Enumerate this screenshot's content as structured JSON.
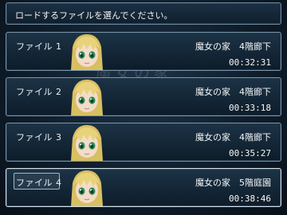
{
  "header": {
    "prompt": "ロードするファイルを選んでください。"
  },
  "watermark": "魔女の家",
  "slots": [
    {
      "label": "ファイル 1",
      "location": "魔女の家　4階廊下",
      "time": "00:32:31",
      "selected": false
    },
    {
      "label": "ファイル 2",
      "location": "魔女の家　4階廊下",
      "time": "00:33:18",
      "selected": false
    },
    {
      "label": "ファイル 3",
      "location": "魔女の家　4階廊下",
      "time": "00:35:27",
      "selected": false
    },
    {
      "label": "ファイル 4",
      "location": "魔女の家　5階庭園",
      "time": "00:38:46",
      "selected": true
    }
  ],
  "colors": {
    "hair": "#e8d27a",
    "eyes": "#2f8a5a",
    "skin": "#f3dcc8",
    "panel_border": "#7a95ab"
  }
}
